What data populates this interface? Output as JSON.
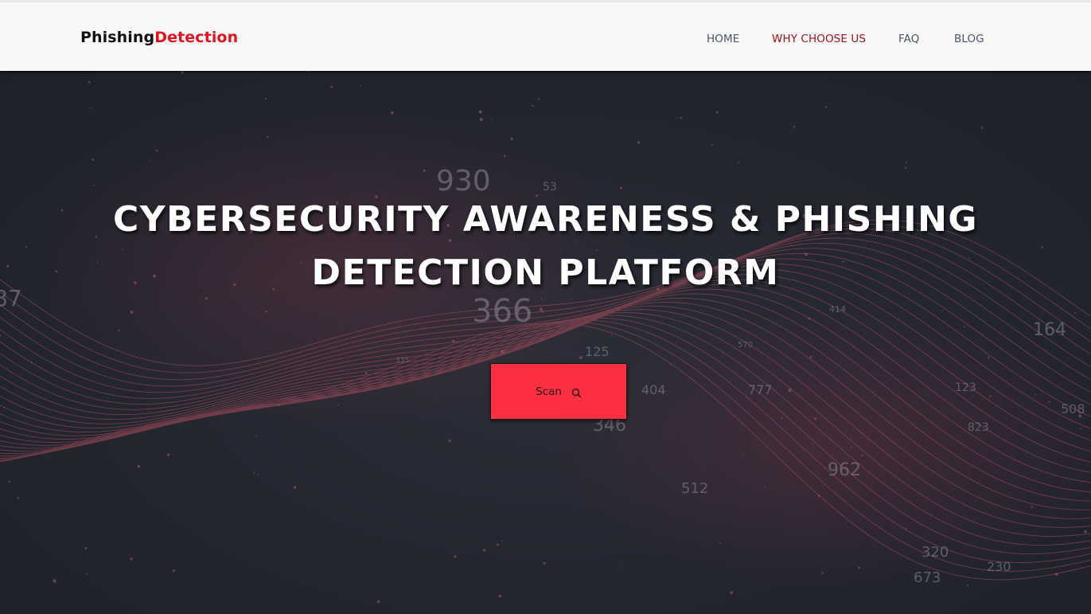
{
  "brand": {
    "part1": "Phishing",
    "part2": "Detection"
  },
  "nav": {
    "items": [
      {
        "label": "HOME",
        "active": false
      },
      {
        "label": "WHY CHOOSE US",
        "active": true
      },
      {
        "label": "FAQ",
        "active": false
      },
      {
        "label": "BLOG",
        "active": false
      }
    ]
  },
  "hero": {
    "title_line1": "CYBERSECURITY AWARENESS & PHISHING",
    "title_line2": "DETECTION PLATFORM",
    "scan_button": {
      "label": "Scan",
      "icon": "search-icon"
    },
    "background_numbers": [
      "930",
      "366",
      "164",
      "512",
      "320",
      "230",
      "673",
      "123",
      "823",
      "404",
      "777",
      "414",
      "508",
      "87",
      "53",
      "125",
      "335",
      "570",
      "962",
      "346"
    ]
  },
  "colors": {
    "navbar_bg": "#f8f8f8",
    "brand_dark": "#111111",
    "brand_red": "#e4121c",
    "nav_text": "#4b5567",
    "nav_active": "#a3101a",
    "hero_bg": "#23252f",
    "wave": "#b0505e",
    "scan_button": "#fd2f40"
  }
}
